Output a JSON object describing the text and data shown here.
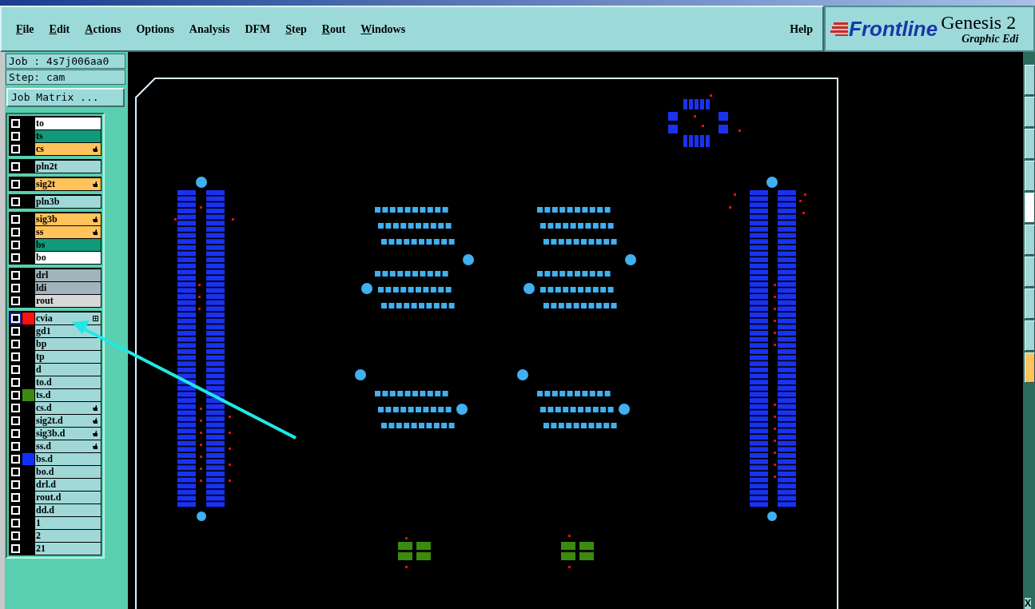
{
  "menu": [
    {
      "label": "File",
      "mnemonic": true
    },
    {
      "label": "Edit",
      "mnemonic": true
    },
    {
      "label": "Actions",
      "mnemonic": true
    },
    {
      "label": "Options",
      "mnemonic": false
    },
    {
      "label": "Analysis",
      "mnemonic": false
    },
    {
      "label": "DFM",
      "mnemonic": false
    },
    {
      "label": "Step",
      "mnemonic": true
    },
    {
      "label": "Rout",
      "mnemonic": true
    },
    {
      "label": "Windows",
      "mnemonic": true
    }
  ],
  "help": "Help",
  "brand": {
    "logo": "Frontline",
    "product": "Genesis 2",
    "subtitle": "Graphic Edi"
  },
  "job": "Job : 4s7j006aa0",
  "step": "Step: cam",
  "job_matrix_button": "Job Matrix ...",
  "layer_groups": [
    [
      {
        "name": "to",
        "kind": "white",
        "selected": false,
        "affected": false
      },
      {
        "name": "ts",
        "kind": "teal",
        "selected": false,
        "affected": false
      },
      {
        "name": "cs",
        "kind": "orange",
        "selected": false,
        "affected": true
      }
    ],
    [
      {
        "name": "pln2t",
        "kind": "cyan",
        "selected": false,
        "affected": false
      }
    ],
    [
      {
        "name": "sig2t",
        "kind": "orange",
        "selected": false,
        "affected": true
      }
    ],
    [
      {
        "name": "pln3b",
        "kind": "cyan",
        "selected": false,
        "affected": false
      }
    ],
    [
      {
        "name": "sig3b",
        "kind": "orange",
        "selected": false,
        "affected": true
      },
      {
        "name": "ss",
        "kind": "orange",
        "selected": false,
        "affected": true
      },
      {
        "name": "bs",
        "kind": "teal",
        "selected": false,
        "affected": false
      },
      {
        "name": "bo",
        "kind": "white",
        "selected": false,
        "affected": false
      }
    ],
    [
      {
        "name": "drl",
        "kind": "slate",
        "selected": false,
        "affected": false
      },
      {
        "name": "ldi",
        "kind": "slate",
        "selected": false,
        "affected": false
      },
      {
        "name": "rout",
        "kind": "grey",
        "selected": false,
        "affected": false
      }
    ],
    [
      {
        "name": "cvia",
        "kind": "cyan",
        "selected": true,
        "affected": false,
        "color": "#ff1010",
        "expandable": true
      },
      {
        "name": "gd1",
        "kind": "cyan",
        "selected": false,
        "affected": false
      },
      {
        "name": "bp",
        "kind": "cyan",
        "selected": false,
        "affected": false
      },
      {
        "name": "tp",
        "kind": "cyan",
        "selected": false,
        "affected": false
      },
      {
        "name": "d",
        "kind": "cyan",
        "selected": false,
        "affected": false
      },
      {
        "name": "to.d",
        "kind": "cyan",
        "selected": false,
        "affected": false
      },
      {
        "name": "ts.d",
        "kind": "cyan",
        "selected": false,
        "affected": false,
        "color": "#3a8c10"
      },
      {
        "name": "cs.d",
        "kind": "cyan",
        "selected": false,
        "affected": true
      },
      {
        "name": "sig2t.d",
        "kind": "cyan",
        "selected": false,
        "affected": true
      },
      {
        "name": "sig3b.d",
        "kind": "cyan",
        "selected": false,
        "affected": true
      },
      {
        "name": "ss.d",
        "kind": "cyan",
        "selected": false,
        "affected": true
      },
      {
        "name": "bs.d",
        "kind": "cyan",
        "selected": false,
        "affected": false,
        "color": "#1030ff"
      },
      {
        "name": "bo.d",
        "kind": "cyan",
        "selected": false,
        "affected": false
      },
      {
        "name": "drl.d",
        "kind": "cyan",
        "selected": false,
        "affected": false
      },
      {
        "name": "rout.d",
        "kind": "cyan",
        "selected": false,
        "affected": false
      },
      {
        "name": "dd.d",
        "kind": "cyan",
        "selected": false,
        "affected": false
      },
      {
        "name": "1",
        "kind": "cyan",
        "selected": false,
        "affected": false
      },
      {
        "name": "2",
        "kind": "cyan",
        "selected": false,
        "affected": false
      },
      {
        "name": "21",
        "kind": "cyan",
        "selected": false,
        "affected": false
      }
    ]
  ],
  "right_toolbar_label": "X"
}
